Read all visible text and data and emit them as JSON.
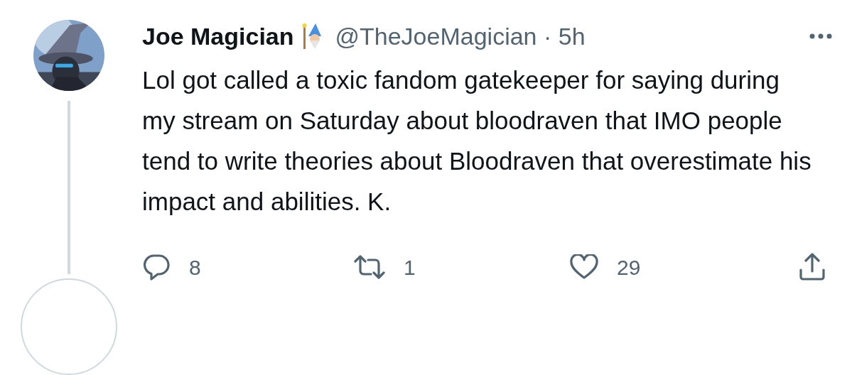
{
  "tweet": {
    "author": {
      "name": "Joe Magician",
      "meta": "@TheJoeMagician · 5h"
    },
    "text": "Lol got called a toxic fandom gatekeeper for saying during my stream on Saturday about bloodraven that IMO people tend to write theories about Bloodraven that overestimate his impact and abilities. K.",
    "actions": [
      {
        "kind": "reply",
        "count": "8"
      },
      {
        "kind": "retweet",
        "count": "1"
      },
      {
        "kind": "like",
        "count": "29"
      },
      {
        "kind": "share"
      }
    ]
  }
}
